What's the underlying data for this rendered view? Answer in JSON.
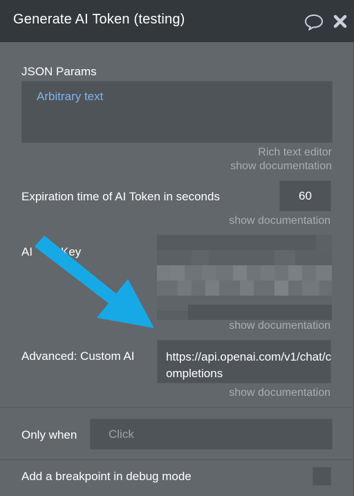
{
  "window": {
    "title": "Generate AI Token (testing)",
    "comment_icon": "speech-bubble-icon",
    "close_icon": "close-x-icon"
  },
  "json_params": {
    "label": "JSON Params",
    "value": "Arbitrary text",
    "hint": "Rich text editor",
    "doc_link": "show documentation"
  },
  "expiration": {
    "label": "Expiration time of AI Token in seconds",
    "value": "60",
    "doc_link": "show documentation"
  },
  "ai_key": {
    "label_left": "AI",
    "label_right": "Key",
    "doc_link": "show documentation"
  },
  "custom_ai": {
    "label": "Advanced: Custom AI",
    "value": "https://api.openai.com/v1/chat/completions",
    "doc_link": "show documentation"
  },
  "only_when": {
    "label": "Only when",
    "placeholder": "Click"
  },
  "breakpoint": {
    "label": "Add a breakpoint in debug mode",
    "checked": false
  },
  "colors": {
    "title_bar": "#33383c",
    "panel": "#62676c",
    "input_bg": "#4f5459",
    "link_text": "#7fb4ee",
    "arrow": "#17a9e6"
  }
}
